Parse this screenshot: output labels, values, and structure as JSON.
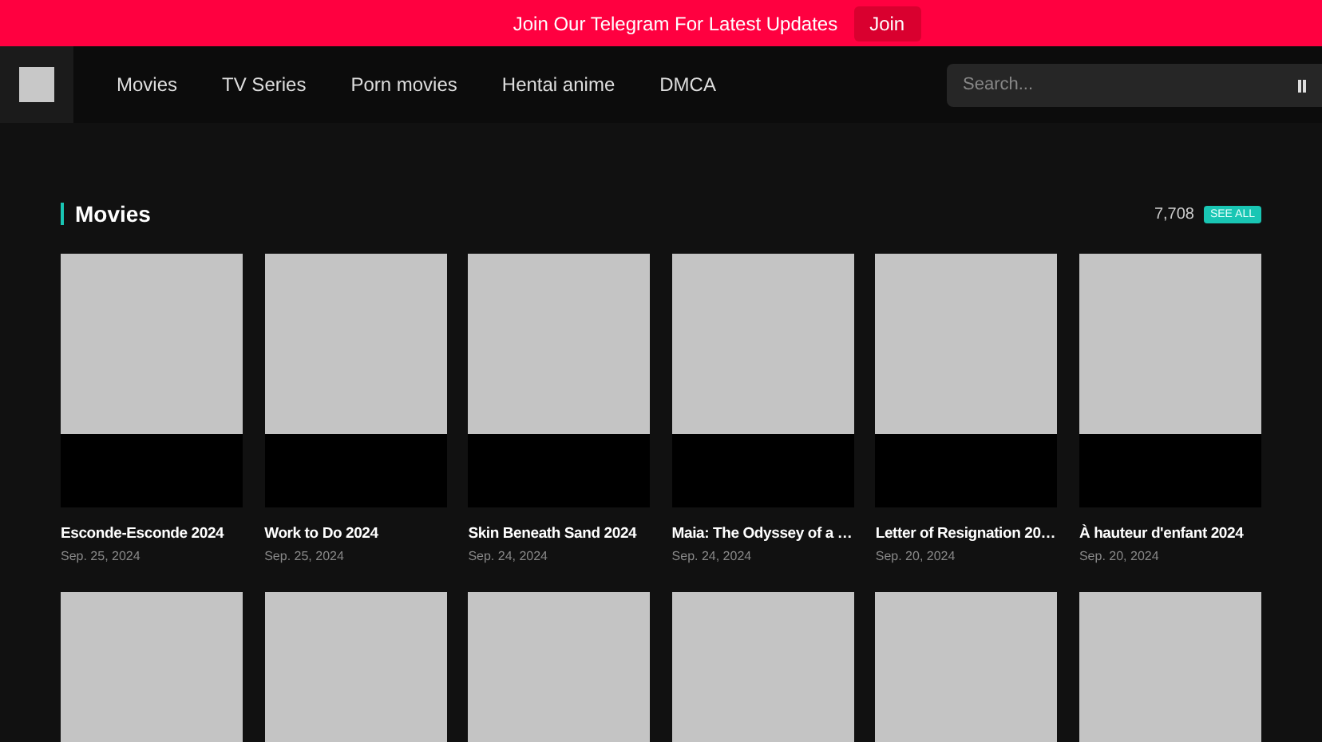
{
  "banner": {
    "text": "Join Our Telegram For Latest Updates",
    "button": "Join"
  },
  "nav": {
    "items": [
      {
        "label": "Movies"
      },
      {
        "label": "TV Series"
      },
      {
        "label": "Porn movies"
      },
      {
        "label": "Hentai anime"
      },
      {
        "label": "DMCA"
      }
    ],
    "search": {
      "placeholder": "Search..."
    }
  },
  "section": {
    "title": "Movies",
    "count": "7,708",
    "see_all": "SEE ALL",
    "movies": [
      {
        "kind": "movie",
        "title": "Esconde-Esconde 2024",
        "date": "Sep. 25, 2024"
      },
      {
        "kind": "movie",
        "title": "Work to Do 2024",
        "date": "Sep. 25, 2024"
      },
      {
        "kind": "movie",
        "title": "Skin Beneath Sand 2024",
        "date": "Sep. 24, 2024"
      },
      {
        "kind": "movie",
        "title": "Maia: The Odyssey of a …",
        "date": "Sep. 24, 2024"
      },
      {
        "kind": "movie",
        "title": "Letter of Resignation 20…",
        "date": "Sep. 20, 2024"
      },
      {
        "kind": "movie",
        "title": "À hauteur d'enfant 2024",
        "date": "Sep. 20, 2024"
      },
      {
        "kind": "poster"
      },
      {
        "kind": "poster"
      },
      {
        "kind": "poster"
      },
      {
        "kind": "poster"
      },
      {
        "kind": "poster"
      },
      {
        "kind": "poster"
      }
    ]
  }
}
